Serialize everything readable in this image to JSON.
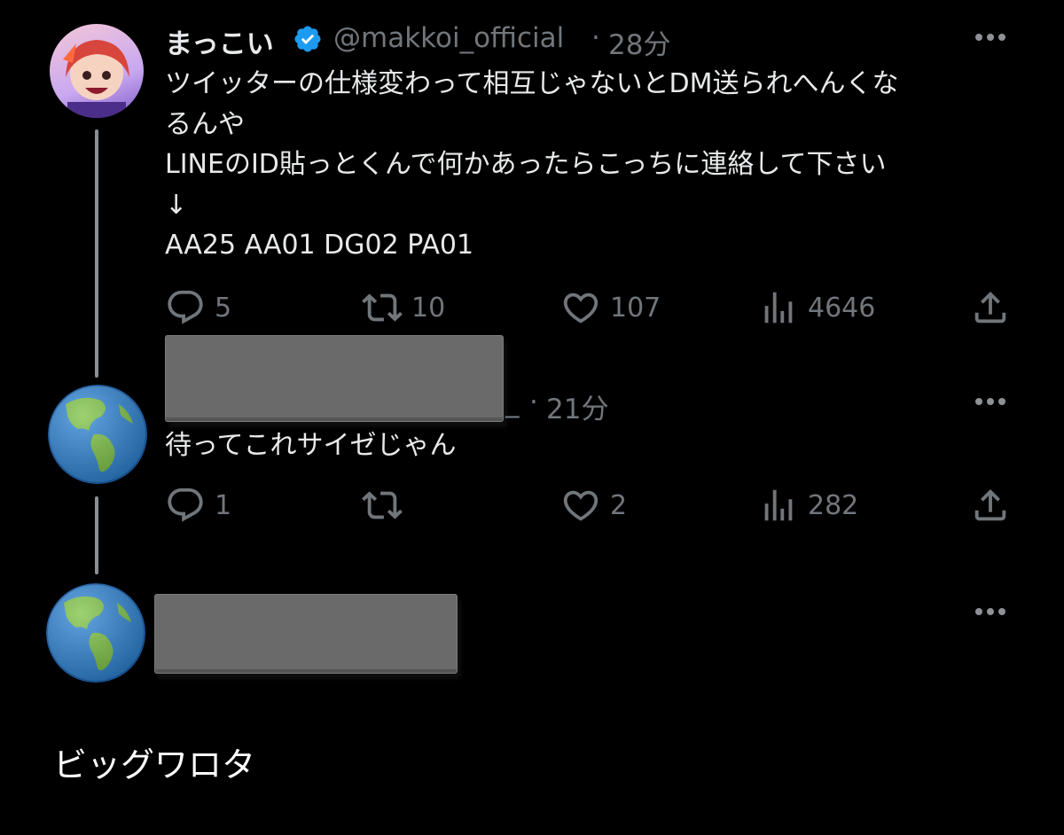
{
  "tweet1": {
    "name": "まっこい",
    "handle": "@makkoi_official",
    "dot": "·",
    "time": "28分",
    "verified_icon": "verified-badge-icon",
    "lines": [
      "ツイッターの仕様変わって相互じゃないとDM送られへんくな",
      "るんや",
      "LINEのID貼っとくんで何かあったらこっちに連絡して下さい",
      "↓",
      "AA25 AA01 DG02 PA01"
    ],
    "actions": {
      "reply_count": "5",
      "retweet_count": "10",
      "like_count": "107",
      "views_count": "4646"
    }
  },
  "tweet2": {
    "handle_tail": "_",
    "dot": "·",
    "time": "21分",
    "avatar_icon": "globe-americas-icon",
    "text": "待ってこれサイゼじゃん",
    "actions": {
      "reply_count": "1",
      "retweet_count": "",
      "like_count": "2",
      "views_count": "282"
    }
  },
  "tweet3": {
    "avatar_icon": "globe-americas-icon"
  },
  "caption": "ビッグワロタ",
  "colors": {
    "background": "#000000",
    "text": "#e7e9ea",
    "muted": "#71767b",
    "verified": "#1d9bf0",
    "redaction": "#6a6a6a"
  }
}
